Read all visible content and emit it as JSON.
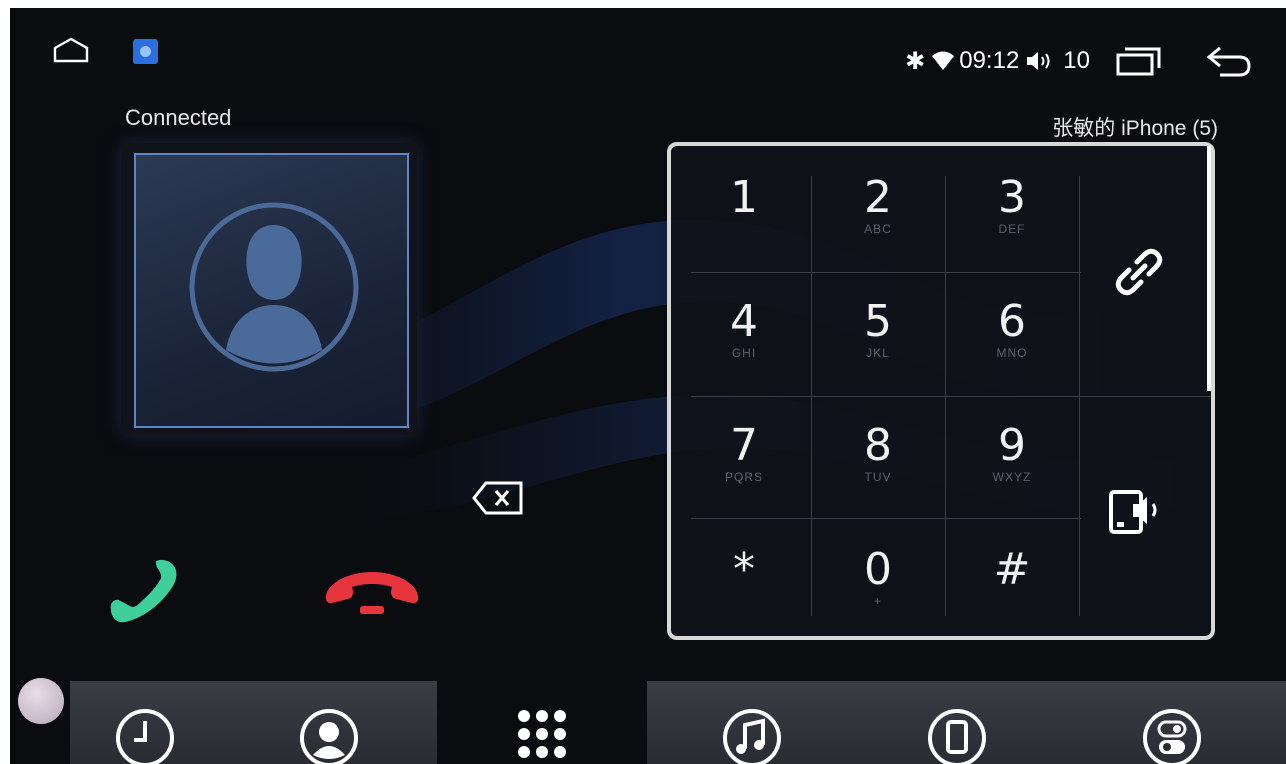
{
  "status_bar": {
    "time": "09:12",
    "volume_level": "10",
    "icons": [
      "home-icon",
      "app-icon",
      "bluetooth-icon",
      "wifi-icon",
      "volume-icon",
      "recent-apps-icon",
      "back-icon"
    ]
  },
  "connection": {
    "status": "Connected",
    "device_name": "张敏的 iPhone (5)"
  },
  "keypad": {
    "keys": [
      {
        "digit": "1",
        "letters": ""
      },
      {
        "digit": "2",
        "letters": "ABC"
      },
      {
        "digit": "3",
        "letters": "DEF"
      },
      {
        "digit": "4",
        "letters": "GHI"
      },
      {
        "digit": "5",
        "letters": "JKL"
      },
      {
        "digit": "6",
        "letters": "MNO"
      },
      {
        "digit": "7",
        "letters": "PQRS"
      },
      {
        "digit": "8",
        "letters": "TUV"
      },
      {
        "digit": "9",
        "letters": "WXYZ"
      },
      {
        "digit": "*",
        "letters": ""
      },
      {
        "digit": "0",
        "letters": "+"
      },
      {
        "digit": "#",
        "letters": ""
      }
    ],
    "side_buttons": [
      "link-icon",
      "audio-transfer-icon"
    ]
  },
  "actions": {
    "call_color": "#3ecf9a",
    "hangup_color": "#e8343c"
  },
  "bottom_tabs": [
    {
      "name": "call-history",
      "icon": "clock-icon"
    },
    {
      "name": "contacts",
      "icon": "contact-icon"
    },
    {
      "name": "dialpad",
      "icon": "dialpad-icon",
      "active": true
    },
    {
      "name": "music",
      "icon": "music-icon"
    },
    {
      "name": "device",
      "icon": "phone-icon"
    },
    {
      "name": "settings",
      "icon": "toggle-icon"
    }
  ]
}
